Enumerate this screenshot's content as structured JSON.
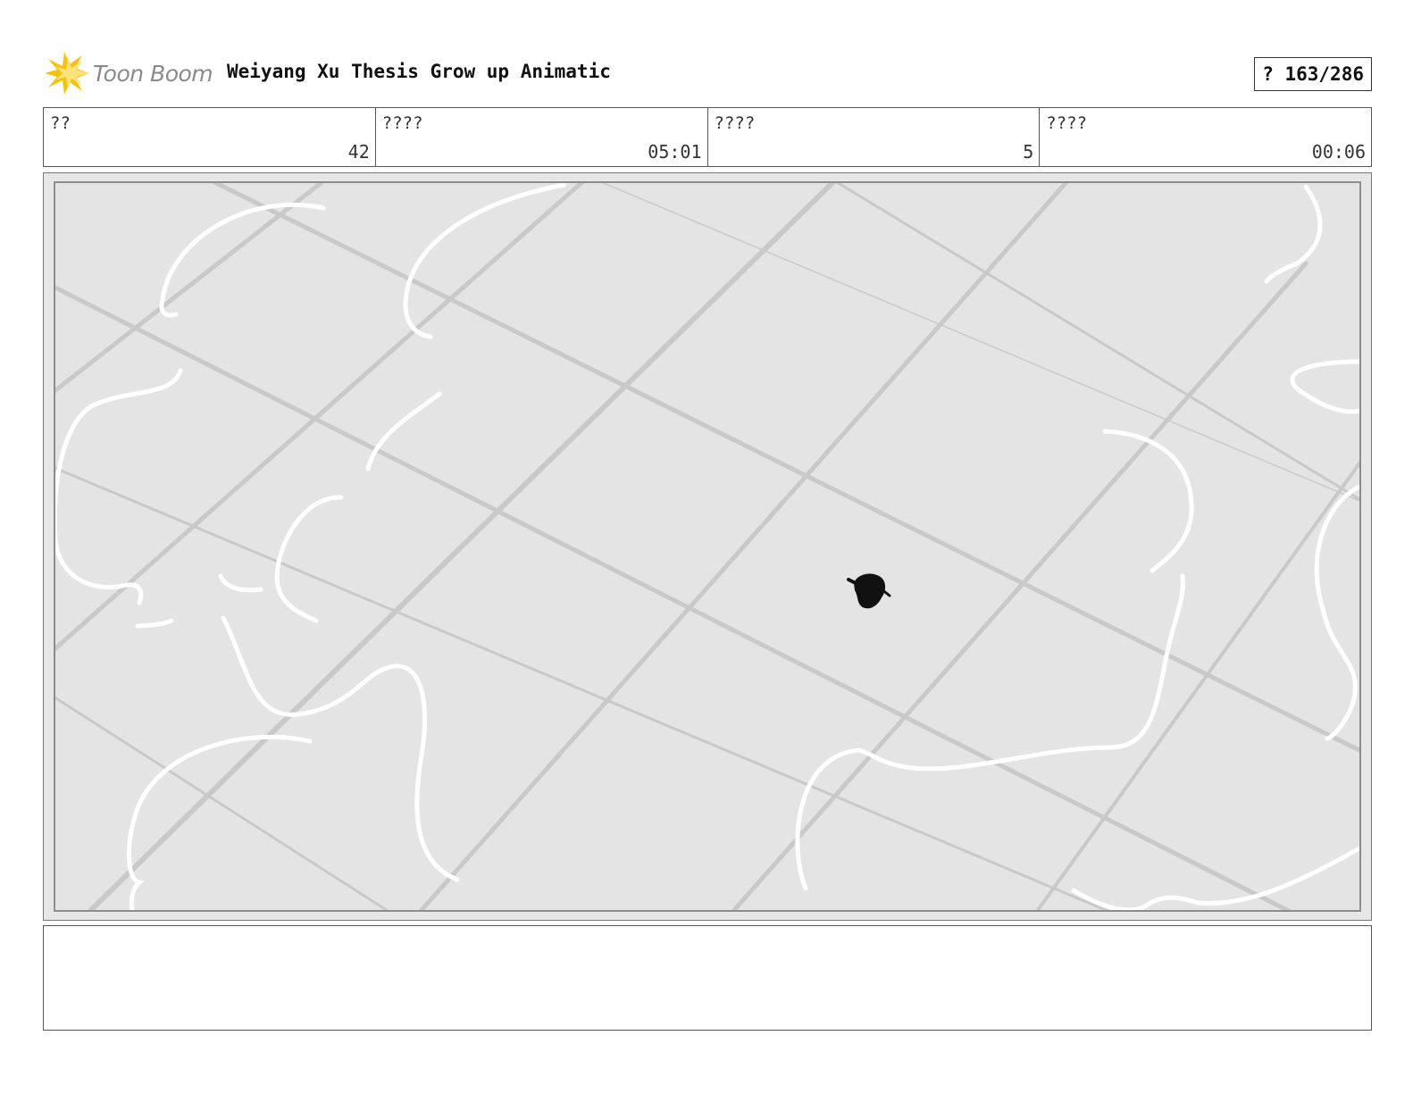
{
  "header": {
    "logo_text": "Toon Boom",
    "title": "Weiyang Xu Thesis Grow up Animatic",
    "page_indicator": "? 163/286"
  },
  "info": [
    {
      "label": "??",
      "value": "42"
    },
    {
      "label": "????",
      "value": "05:01"
    },
    {
      "label": "????",
      "value": "5"
    },
    {
      "label": "????",
      "value": "00:06"
    }
  ],
  "panel": {
    "background_color": "#e4e4e4",
    "grid_line_color": "#c8c8c8",
    "sketch_color": "#ffffff",
    "figure_color": "#111111"
  },
  "notes": ""
}
